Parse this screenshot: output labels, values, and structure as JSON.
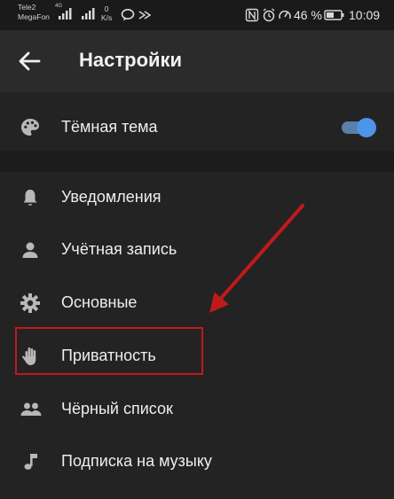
{
  "status_bar": {
    "carrier_1": "Tele2",
    "carrier_2": "MegaFon",
    "network_type": "4G",
    "speed_value": "0",
    "speed_unit": "K/s",
    "battery_percent": "46 %",
    "time": "10:09"
  },
  "app_bar": {
    "title": "Настройки",
    "back_icon": "arrow-left-icon"
  },
  "dark_theme": {
    "label": "Тёмная тема",
    "icon": "palette-icon",
    "enabled": true,
    "accent_color": "#4d95ea"
  },
  "menu": {
    "items": [
      {
        "label": "Уведомления",
        "icon": "bell-icon"
      },
      {
        "label": "Учётная запись",
        "icon": "person-icon"
      },
      {
        "label": "Основные",
        "icon": "gear-icon"
      },
      {
        "label": "Приватность",
        "icon": "hand-icon"
      },
      {
        "label": "Чёрный список",
        "icon": "people-icon"
      },
      {
        "label": "Подписка на музыку",
        "icon": "music-note-icon"
      }
    ]
  },
  "annotation": {
    "highlighted_item": "Приватность",
    "color": "#c0191c"
  }
}
